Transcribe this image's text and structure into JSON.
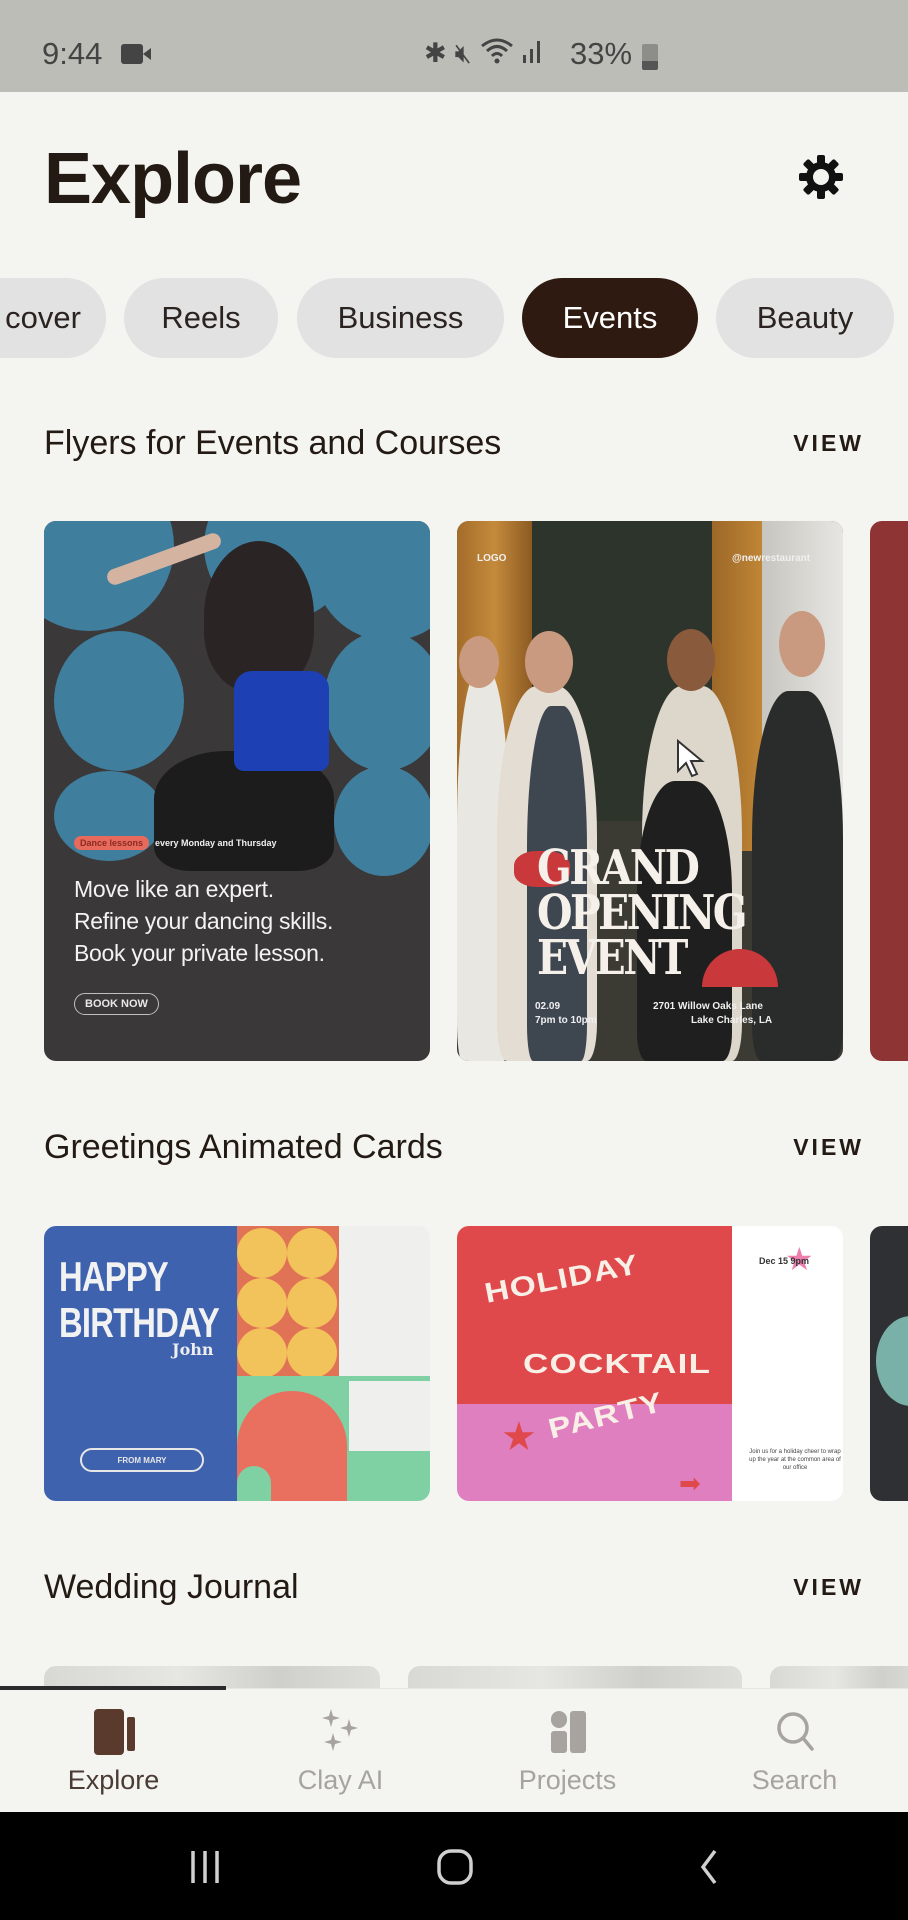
{
  "status_bar": {
    "time": "9:44",
    "battery_percent": "33%",
    "icons": [
      "video-camera-icon",
      "bluetooth-icon",
      "mute-icon",
      "wifi-icon",
      "signal-icon",
      "battery-icon"
    ]
  },
  "header": {
    "title": "Explore",
    "settings_icon": "gear-icon"
  },
  "chips": [
    {
      "label": "Discover",
      "visible_text": "cover",
      "active": false
    },
    {
      "label": "Reels",
      "active": false
    },
    {
      "label": "Business",
      "active": false
    },
    {
      "label": "Events",
      "active": true
    },
    {
      "label": "Beauty",
      "active": false
    }
  ],
  "sections": [
    {
      "title": "Flyers for Events and Courses",
      "view_label": "VIEW",
      "cards": [
        {
          "name": "dance-lesson-flyer",
          "tag": "Dance lessons",
          "tag_extra": "every Monday and Thursday",
          "lines": [
            "Move like an expert.",
            "Refine your dancing skills.",
            "Book your private lesson."
          ],
          "button": "BOOK NOW"
        },
        {
          "name": "grand-opening-flyer",
          "logo": "LOGO",
          "handle": "@newrestaurant",
          "headline": [
            "GRAND",
            "OPENING",
            "EVENT"
          ],
          "date": "02.09",
          "hours": "7pm to 10pm",
          "address_line1": "2701 Willow Oaks Lane",
          "address_line2": "Lake Charles, LA"
        }
      ]
    },
    {
      "title": "Greetings Animated Cards",
      "view_label": "VIEW",
      "cards": [
        {
          "name": "happy-birthday-card",
          "headline": [
            "HAPPY",
            "BIRTHDAY"
          ],
          "recipient": "John",
          "from": "FROM MARY"
        },
        {
          "name": "holiday-cocktail-card",
          "words": [
            "HOLIDAY",
            "COCKTAIL",
            "PARTY"
          ],
          "date": "Dec 15 9pm",
          "description": "Join us for a holiday cheer to wrap up the year at the common area of our office"
        }
      ]
    },
    {
      "title": "Wedding Journal",
      "view_label": "VIEW"
    }
  ],
  "bottom_nav": {
    "tabs": [
      {
        "label": "Explore",
        "icon": "explore-cards-icon",
        "active": true
      },
      {
        "label": "Clay AI",
        "icon": "sparkles-icon",
        "active": false
      },
      {
        "label": "Projects",
        "icon": "projects-icon",
        "active": false
      },
      {
        "label": "Search",
        "icon": "search-icon",
        "active": false
      }
    ]
  },
  "system_nav": [
    "recent-apps-icon",
    "home-icon",
    "back-icon"
  ],
  "colors": {
    "background": "#f4f4f0",
    "accent_dark": "#2e1a10",
    "chip_bg": "#e2e2e2",
    "active_tab": "#4a3b34",
    "inactive_tab": "#a7a49f"
  }
}
